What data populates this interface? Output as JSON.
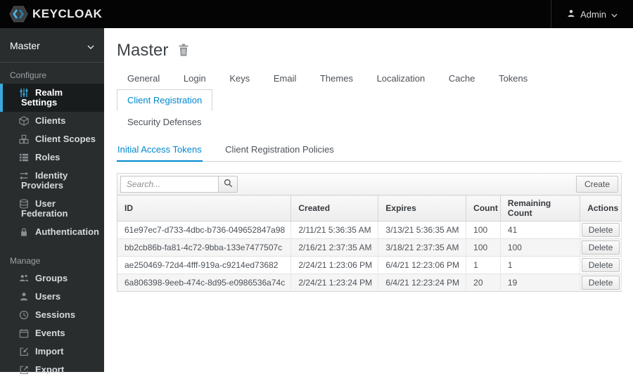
{
  "colors": {
    "topbar_bg": "#040404",
    "sidebar_bg": "#292d2e",
    "sidebar_active_accent": "#39a9dc",
    "link_blue": "#0088ce"
  },
  "topbar": {
    "logo_text": "KEYCLOAK",
    "logo_icon": "keycloak-hexagon-icon",
    "user_menu": {
      "label": "Admin",
      "icon": "user-icon",
      "caret": "chevron-down-icon"
    }
  },
  "sidebar": {
    "realm_selector": {
      "value": "Master",
      "caret": "chevron-down-icon"
    },
    "sections": [
      {
        "label": "Configure",
        "items": [
          {
            "label": "Realm Settings",
            "icon": "sliders-icon",
            "active": true
          },
          {
            "label": "Clients",
            "icon": "cube-icon",
            "active": false
          },
          {
            "label": "Client Scopes",
            "icon": "cubes-icon",
            "active": false
          },
          {
            "label": "Roles",
            "icon": "list-icon",
            "active": false
          },
          {
            "label": "Identity Providers",
            "icon": "exchange-arrows-icon",
            "active": false
          },
          {
            "label": "User Federation",
            "icon": "database-icon",
            "active": false
          },
          {
            "label": "Authentication",
            "icon": "lock-icon",
            "active": false
          }
        ]
      },
      {
        "label": "Manage",
        "items": [
          {
            "label": "Groups",
            "icon": "users-icon",
            "active": false
          },
          {
            "label": "Users",
            "icon": "user-icon",
            "active": false
          },
          {
            "label": "Sessions",
            "icon": "clock-icon",
            "active": false
          },
          {
            "label": "Events",
            "icon": "calendar-icon",
            "active": false
          },
          {
            "label": "Import",
            "icon": "import-icon",
            "active": false
          },
          {
            "label": "Export",
            "icon": "export-icon",
            "active": false
          }
        ]
      }
    ]
  },
  "main": {
    "title": "Master",
    "title_action_icon": "trash-icon",
    "tabs": [
      {
        "label": "General",
        "active": false
      },
      {
        "label": "Login",
        "active": false
      },
      {
        "label": "Keys",
        "active": false
      },
      {
        "label": "Email",
        "active": false
      },
      {
        "label": "Themes",
        "active": false
      },
      {
        "label": "Localization",
        "active": false
      },
      {
        "label": "Cache",
        "active": false
      },
      {
        "label": "Tokens",
        "active": false
      },
      {
        "label": "Client Registration",
        "active": true
      },
      {
        "label": "Security Defenses",
        "active": false
      }
    ],
    "subtabs": [
      {
        "label": "Initial Access Tokens",
        "active": true
      },
      {
        "label": "Client Registration Policies",
        "active": false
      }
    ],
    "toolbar": {
      "search_placeholder": "Search...",
      "search_icon": "search-icon",
      "create_label": "Create"
    },
    "table": {
      "columns": [
        "ID",
        "Created",
        "Expires",
        "Count",
        "Remaining Count",
        "Actions"
      ],
      "rows": [
        {
          "id": "61e97ec7-d733-4dbc-b736-049652847a98",
          "created": "2/11/21 5:36:35 AM",
          "expires": "3/13/21 5:36:35 AM",
          "count": "100",
          "remaining_count": "41",
          "action": "Delete"
        },
        {
          "id": "bb2cb86b-fa81-4c72-9bba-133e7477507c",
          "created": "2/16/21 2:37:35 AM",
          "expires": "3/18/21 2:37:35 AM",
          "count": "100",
          "remaining_count": "100",
          "action": "Delete"
        },
        {
          "id": "ae250469-72d4-4fff-919a-c9214ed73682",
          "created": "2/24/21 1:23:06 PM",
          "expires": "6/4/21 12:23:06 PM",
          "count": "1",
          "remaining_count": "1",
          "action": "Delete"
        },
        {
          "id": "6a806398-9eeb-474c-8d95-e0986536a74c",
          "created": "2/24/21 1:23:24 PM",
          "expires": "6/4/21 12:23:24 PM",
          "count": "20",
          "remaining_count": "19",
          "action": "Delete"
        }
      ]
    }
  }
}
